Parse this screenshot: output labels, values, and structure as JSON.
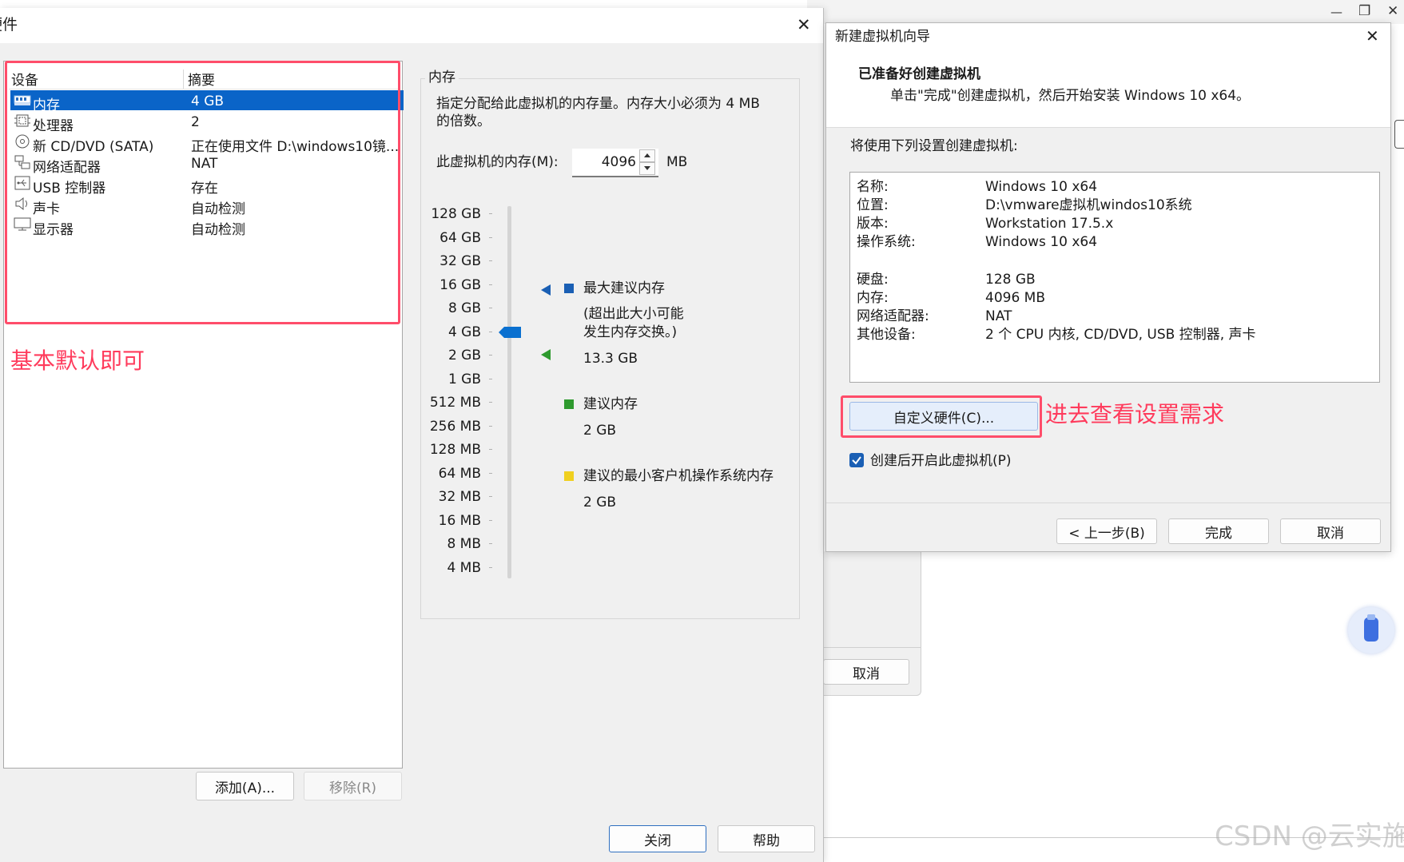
{
  "hw_dialog": {
    "title": "硬件",
    "close_glyph": "✕",
    "columns": [
      "设备",
      "摘要"
    ],
    "devices": [
      {
        "name": "内存",
        "summary": "4 GB",
        "icon": "memory-icon",
        "selected": true
      },
      {
        "name": "处理器",
        "summary": "2",
        "icon": "cpu-icon",
        "selected": false
      },
      {
        "name": "新 CD/DVD (SATA)",
        "summary": "正在使用文件 D:\\windows10镜...",
        "icon": "cd-icon",
        "selected": false
      },
      {
        "name": "网络适配器",
        "summary": "NAT",
        "icon": "network-icon",
        "selected": false
      },
      {
        "name": "USB 控制器",
        "summary": "存在",
        "icon": "usb-icon",
        "selected": false
      },
      {
        "name": "声卡",
        "summary": "自动检测",
        "icon": "speaker-icon",
        "selected": false
      },
      {
        "name": "显示器",
        "summary": "自动检测",
        "icon": "monitor-icon",
        "selected": false
      }
    ],
    "annotation": "基本默认即可",
    "add_label": "添加(A)...",
    "remove_label": "移除(R)",
    "close_label": "关闭",
    "help_label": "帮助",
    "memory": {
      "group_title": "内存",
      "description_line1": "指定分配给此虚拟机的内存量。内存大小必须为 4 MB",
      "description_line2": "的倍数。",
      "field_label": "此虚拟机的内存(M):",
      "value": "4096",
      "unit": "MB",
      "scale": [
        "128 GB",
        "64 GB",
        "32 GB",
        "16 GB",
        "8 GB",
        "4 GB",
        "2 GB",
        "1 GB",
        "512 MB",
        "256 MB",
        "128 MB",
        "64 MB",
        "32 MB",
        "16 MB",
        "8 MB",
        "4 MB"
      ],
      "slider_value": "4 GB",
      "max_label": "最大建议内存",
      "max_note_line1": "(超出此大小可能",
      "max_note_line2": "发生内存交换。)",
      "max_value": "13.3 GB",
      "rec_label": "建议内存",
      "rec_value": "2 GB",
      "min_label": "建议的最小客户机操作系统内存",
      "min_value": "2 GB"
    }
  },
  "wizard": {
    "title": "新建虚拟机向导",
    "close_glyph": "✕",
    "heading": "已准备好创建虚拟机",
    "subheading": "单击\"完成\"创建虚拟机，然后开始安装 Windows 10 x64。",
    "section_label": "将使用下列设置创建虚拟机:",
    "settings": [
      {
        "key": "名称:",
        "value": "Windows 10 x64"
      },
      {
        "key": "位置:",
        "value": "D:\\vmware虚拟机windos10系统"
      },
      {
        "key": "版本:",
        "value": "Workstation 17.5.x"
      },
      {
        "key": "操作系统:",
        "value": "Windows 10 x64"
      },
      {
        "key": "硬盘:",
        "value": "128 GB"
      },
      {
        "key": "内存:",
        "value": "4096 MB"
      },
      {
        "key": "网络适配器:",
        "value": "NAT"
      },
      {
        "key": "其他设备:",
        "value": "2 个 CPU 内核, CD/DVD, USB 控制器, 声卡"
      }
    ],
    "customize_label": "自定义硬件(C)...",
    "annotation": "进去查看设置需求",
    "autostart_label": "创建后开启此虚拟机(P)",
    "autostart_checked": true,
    "back_label": "< 上一步(B)",
    "finish_label": "完成",
    "cancel_label": "取消"
  },
  "background": {
    "cancel_label": "取消",
    "minimize_glyph": "—",
    "restore_glyph": "❐",
    "close_glyph": "✕",
    "watermark": "CSDN @云实施"
  },
  "colors": {
    "selection": "#0a64c8",
    "max_marker": "#1a5fb4",
    "rec_marker": "#2e9a2e",
    "min_marker": "#f0d020",
    "annotation": "#ff3b5c"
  }
}
